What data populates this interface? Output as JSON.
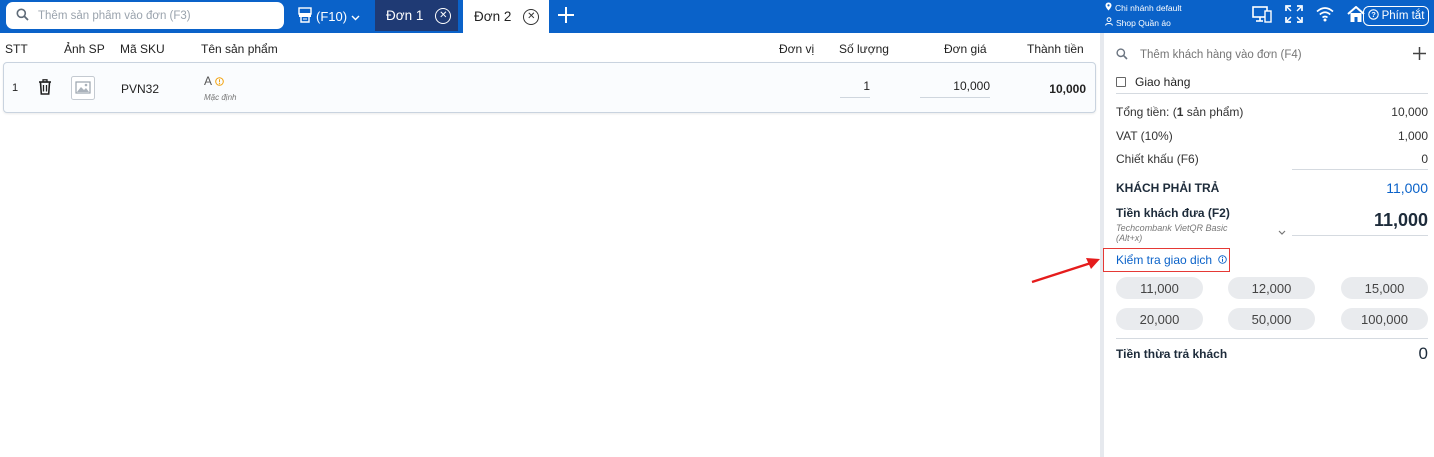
{
  "topbar": {
    "search_placeholder": "Thêm sản phẩm vào đơn (F3)",
    "printer_label": "(F10)",
    "tabs": [
      {
        "label": "Đơn 1"
      },
      {
        "label": "Đơn 2"
      }
    ],
    "branch": "Chi nhánh default",
    "shop": "Shop Quần áo",
    "shortcut_label": "Phím tắt"
  },
  "table": {
    "headers": {
      "stt": "STT",
      "image": "Ảnh SP",
      "sku": "Mã SKU",
      "name": "Tên sản phẩm",
      "unit": "Đơn vị",
      "qty": "Số lượng",
      "price": "Đơn giá",
      "total": "Thành tiền"
    },
    "rows": [
      {
        "stt": "1",
        "sku": "PVN32",
        "name": "A",
        "variant": "Mặc định",
        "unit": "",
        "qty": "1",
        "price": "10,000",
        "total": "10,000"
      }
    ]
  },
  "panel": {
    "customer_placeholder": "Thêm khách hàng vào đơn (F4)",
    "delivery_label": "Giao hàng",
    "total_label_prefix": "Tổng tiền: (",
    "total_count": "1",
    "total_label_suffix": " sản phẩm)",
    "total_value": "10,000",
    "vat_label": "VAT (10%)",
    "vat_value": "1,000",
    "discount_label": "Chiết khấu (F6)",
    "discount_value": "0",
    "payable_label": "KHÁCH PHẢI TRẢ",
    "payable_value": "11,000",
    "paid_label": "Tiền khách đưa (F2)",
    "paid_method": "Techcombank VietQR Basic (Alt+x)",
    "paid_value": "11,000",
    "check_transaction": "Kiểm tra giao dịch",
    "quick_amounts": [
      "11,000",
      "12,000",
      "15,000",
      "20,000",
      "50,000",
      "100,000"
    ],
    "change_label": "Tiền thừa trả khách",
    "change_value": "0"
  },
  "colors": {
    "topbar": "#0a62c9",
    "active_tab": "#1f3a74",
    "accent_blue": "#0a62c9",
    "highlight_box": "#e53935",
    "annotation_arrow": "#e51c1c",
    "warning_icon": "#f2a20c"
  }
}
